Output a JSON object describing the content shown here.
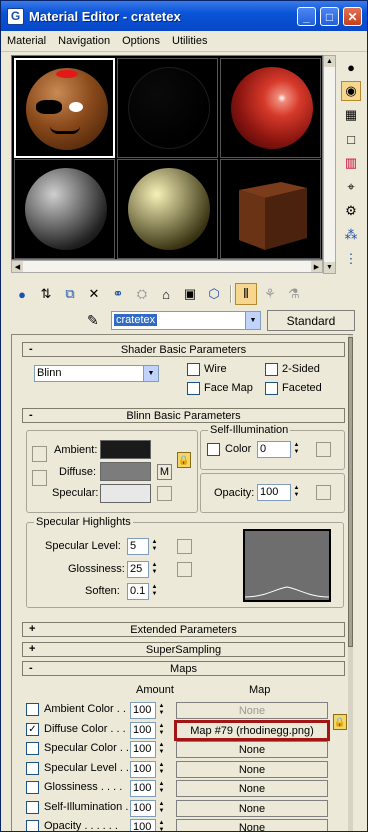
{
  "window": {
    "title": "Material Editor - cratetex",
    "app_icon": "G",
    "min": "_",
    "max": "□",
    "close": "✕"
  },
  "menu": [
    "Material",
    "Navigation",
    "Options",
    "Utilities"
  ],
  "slots": [
    {
      "name": "face-sphere",
      "colors": [
        "#8a4a1b",
        "#3a1a05"
      ]
    },
    {
      "name": "black-sphere",
      "colors": [
        "#0a0a0a",
        "#000000"
      ]
    },
    {
      "name": "red-sphere",
      "colors": [
        "#d63a2a",
        "#3a0808"
      ]
    },
    {
      "name": "gray-sphere",
      "colors": [
        "#cfcfcf",
        "#202020"
      ]
    },
    {
      "name": "cream-sphere",
      "colors": [
        "#f6f0b8",
        "#3e3816"
      ]
    },
    {
      "name": "crate-cube",
      "colors": [
        "#6b3316",
        "#3e1a08"
      ]
    }
  ],
  "name_row": {
    "material_name": "cratetex",
    "type_button": "Standard"
  },
  "shader_basic": {
    "title": "Shader Basic Parameters",
    "sign": "-",
    "shader": "Blinn",
    "wire": "Wire",
    "two_sided": "2-Sided",
    "face_map": "Face Map",
    "faceted": "Faceted"
  },
  "blinn_basic": {
    "title": "Blinn Basic Parameters",
    "sign": "-",
    "ambient": "Ambient:",
    "diffuse": "Diffuse:",
    "specular": "Specular:",
    "m": "M",
    "self_illum_group": "Self-Illumination",
    "color_label": "Color",
    "color_value": "0",
    "opacity_label": "Opacity:",
    "opacity_value": "100",
    "ambient_color": "#1a1a1a",
    "diffuse_color": "#7c7c7c",
    "specular_color": "#e8e8e8"
  },
  "specular_highlights": {
    "title": "Specular Highlights",
    "level_label": "Specular Level:",
    "level_value": "5",
    "gloss_label": "Glossiness:",
    "gloss_value": "25",
    "soften_label": "Soften:",
    "soften_value": "0.1"
  },
  "collapsed_rollouts": [
    {
      "sign": "+",
      "title": "Extended Parameters"
    },
    {
      "sign": "+",
      "title": "SuperSampling"
    }
  ],
  "maps": {
    "sign": "-",
    "title": "Maps",
    "amount_header": "Amount",
    "map_header": "Map",
    "rows": [
      {
        "label": "Ambient Color . .",
        "checked": false,
        "amount": "100",
        "map": "None",
        "disabled": true
      },
      {
        "label": "Diffuse Color . . .",
        "checked": true,
        "amount": "100",
        "map": "Map #79 (rhodinegg.png)",
        "disabled": false,
        "highlighted": true
      },
      {
        "label": "Specular Color . .",
        "checked": false,
        "amount": "100",
        "map": "None",
        "disabled": false
      },
      {
        "label": "Specular Level . .",
        "checked": false,
        "amount": "100",
        "map": "None",
        "disabled": false
      },
      {
        "label": "Glossiness . . . .",
        "checked": false,
        "amount": "100",
        "map": "None",
        "disabled": false
      },
      {
        "label": "Self-Illumination .",
        "checked": false,
        "amount": "100",
        "map": "None",
        "disabled": false
      },
      {
        "label": "Opacity . . . . . .",
        "checked": false,
        "amount": "100",
        "map": "None",
        "disabled": false
      }
    ]
  }
}
